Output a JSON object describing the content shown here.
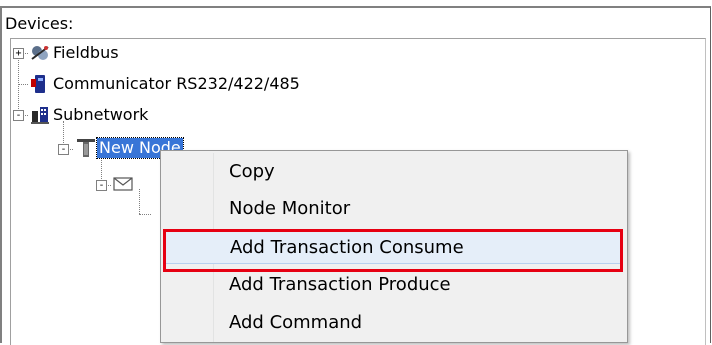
{
  "panel": {
    "title": "Devices:"
  },
  "tree": {
    "nodes": [
      {
        "label": "Fieldbus",
        "icon": "fieldbus-icon",
        "expander": "+"
      },
      {
        "label": "Communicator RS232/422/485",
        "icon": "communicator-icon"
      },
      {
        "label": "Subnetwork",
        "icon": "subnetwork-icon",
        "expander": "-"
      },
      {
        "label": "New Node",
        "icon": "node-icon",
        "expander": "-",
        "selected": true
      },
      {
        "label": "",
        "icon": "envelope-icon",
        "expander": "-"
      }
    ]
  },
  "context_menu": {
    "items": [
      {
        "label": "Copy"
      },
      {
        "label": "Node Monitor"
      },
      {
        "label": "Add Transaction Consume",
        "highlighted": true
      },
      {
        "label": "Add Transaction Produce"
      },
      {
        "label": "Add Command"
      }
    ]
  },
  "colors": {
    "selection": "#3875d7",
    "highlight_box": "#e60012",
    "menu_background": "#f0f0f0"
  }
}
